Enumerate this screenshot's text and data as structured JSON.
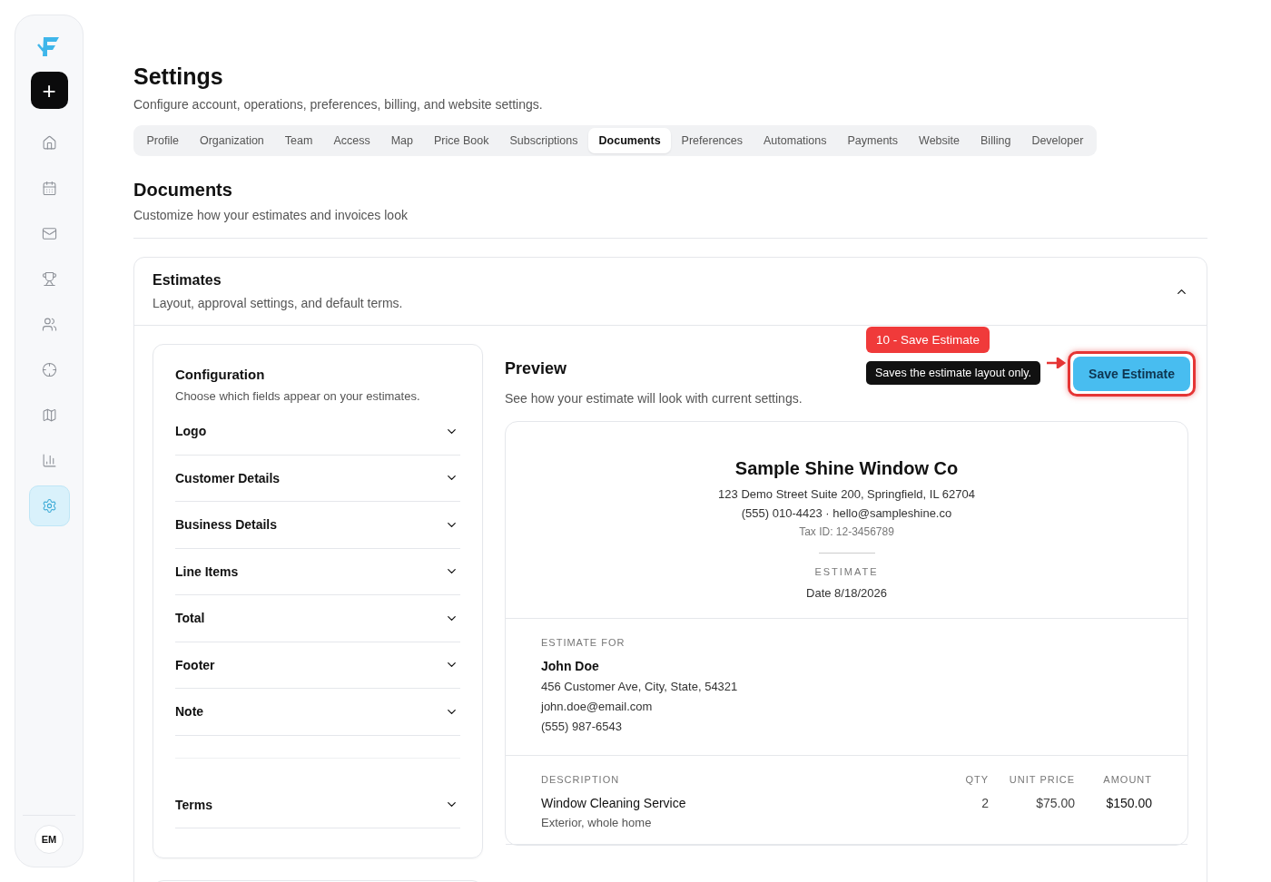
{
  "sidebar": {
    "new_button": "+",
    "items": [
      {
        "selected": false
      },
      {
        "selected": false
      },
      {
        "selected": false
      },
      {
        "selected": false
      },
      {
        "selected": false
      },
      {
        "selected": false
      },
      {
        "selected": false
      },
      {
        "selected": false
      },
      {
        "selected": true
      }
    ],
    "avatar": "EM"
  },
  "page": {
    "title": "Settings",
    "subtitle": "Configure account, operations, preferences, billing, and website settings."
  },
  "tabs": [
    {
      "label": "Profile",
      "selected": false
    },
    {
      "label": "Organization",
      "selected": false
    },
    {
      "label": "Team",
      "selected": false
    },
    {
      "label": "Access",
      "selected": false
    },
    {
      "label": "Map",
      "selected": false
    },
    {
      "label": "Price Book",
      "selected": false
    },
    {
      "label": "Subscriptions",
      "selected": false
    },
    {
      "label": "Documents",
      "selected": true
    },
    {
      "label": "Preferences",
      "selected": false
    },
    {
      "label": "Automations",
      "selected": false
    },
    {
      "label": "Payments",
      "selected": false
    },
    {
      "label": "Website",
      "selected": false
    },
    {
      "label": "Billing",
      "selected": false
    },
    {
      "label": "Developer",
      "selected": false
    }
  ],
  "section": {
    "title": "Documents",
    "subtitle": "Customize how your estimates and invoices look"
  },
  "estimates": {
    "title": "Estimates",
    "subtitle": "Layout, approval settings, and default terms.",
    "expanded": true,
    "configuration": {
      "title": "Configuration",
      "subtitle": "Choose which fields appear on your estimates.",
      "fields": [
        {
          "kind": "field",
          "label": "Logo",
          "expanded": false
        },
        {
          "kind": "field",
          "label": "Customer Details",
          "expanded": false
        },
        {
          "kind": "field",
          "label": "Business Details",
          "expanded": false
        },
        {
          "kind": "field",
          "label": "Line Items",
          "expanded": false
        },
        {
          "kind": "field",
          "label": "Total",
          "expanded": false
        },
        {
          "kind": "field",
          "label": "Footer",
          "expanded": false
        },
        {
          "kind": "field",
          "label": "Note",
          "expanded": false
        },
        {
          "kind": "blank"
        },
        {
          "kind": "field",
          "label": "Terms",
          "expanded": false
        }
      ]
    },
    "preview": {
      "title": "Preview",
      "subtitle": "See how your estimate will look with current settings.",
      "save_button": "Save Estimate",
      "annotation": {
        "badge": "10 - Save Estimate",
        "tooltip": "Saves the estimate layout only."
      },
      "document": {
        "company": "Sample Shine Window Co",
        "address": "123 Demo Street Suite 200, Springfield, IL 62704",
        "contact": "(555) 010-4423 · hello@sampleshine.co",
        "tax_id": "Tax ID: 12-3456789",
        "doc_label": "ESTIMATE",
        "date": "Date 8/18/2026",
        "bill_to": {
          "label": "ESTIMATE FOR",
          "name": "John Doe",
          "lines": [
            "456 Customer Ave, City, State, 54321",
            "john.doe@email.com",
            "(555) 987-6543"
          ]
        },
        "columns": [
          "DESCRIPTION",
          "QTY",
          "UNIT PRICE",
          "AMOUNT"
        ],
        "rows": [
          {
            "description": "Window Cleaning Service",
            "detail": "Exterior, whole home",
            "qty": "2",
            "unit_price": "$75.00",
            "amount": "$150.00"
          }
        ]
      }
    }
  }
}
